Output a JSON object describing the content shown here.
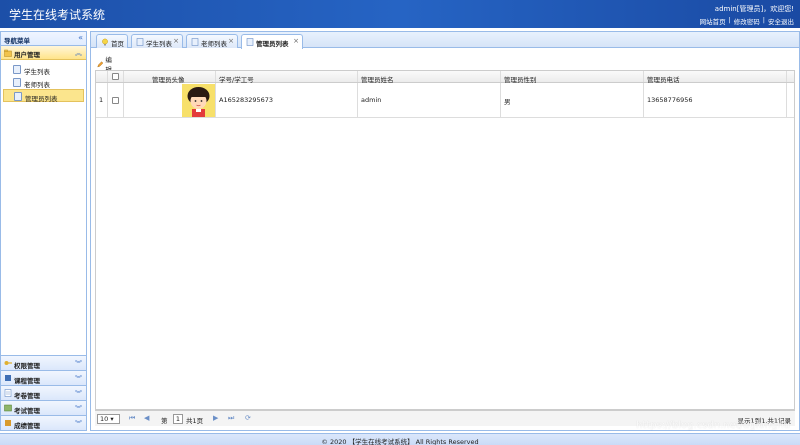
{
  "header": {
    "title": "学生在线考试系统",
    "greeting": "admin[管理员]，欢迎您!",
    "links": [
      "网站首页",
      "修改密码",
      "安全退出"
    ],
    "separator": "|"
  },
  "sidebar": {
    "heading": "导航菜单",
    "collapse_glyph": "«",
    "active_panel": {
      "title": "用户管理",
      "icon": "folder-user-icon"
    },
    "menu": [
      {
        "label": "学生列表",
        "icon": "page-icon"
      },
      {
        "label": "老师列表",
        "icon": "page-icon"
      },
      {
        "label": "管理员列表",
        "icon": "page-icon",
        "active": true
      }
    ],
    "panels": [
      {
        "title": "权限管理",
        "icon": "key-icon"
      },
      {
        "title": "课程管理",
        "icon": "book-icon"
      },
      {
        "title": "考卷管理",
        "icon": "paper-icon"
      },
      {
        "title": "考试管理",
        "icon": "exam-icon"
      },
      {
        "title": "成绩管理",
        "icon": "grade-icon"
      }
    ]
  },
  "tabs": [
    {
      "label": "首页",
      "closable": false
    },
    {
      "label": "学生列表",
      "closable": true
    },
    {
      "label": "老师列表",
      "closable": true
    },
    {
      "label": "管理员列表",
      "closable": true,
      "active": true
    }
  ],
  "toolbar": {
    "edit_label": "编辑"
  },
  "grid": {
    "columns": [
      "管理员头像",
      "学号/学工号",
      "管理员姓名",
      "管理员性别",
      "管理员电话"
    ],
    "rows": [
      {
        "index": "1",
        "id": "A165283295673",
        "name": "admin",
        "gender": "男",
        "phone": "13658776956"
      }
    ]
  },
  "pager": {
    "page_size": "10",
    "page_prefix": "第",
    "page_number": "1",
    "page_suffix": "共1页",
    "info": "显示1到1,共1记录"
  },
  "footer": "© 2020 【学生在线考试系统】 All Rights Reserved",
  "watermark": "https://blog.csdn.net/dgiongnu",
  "colors": {
    "header": "#2664c4",
    "border": "#99bbe8",
    "active": "#fbe58d"
  }
}
